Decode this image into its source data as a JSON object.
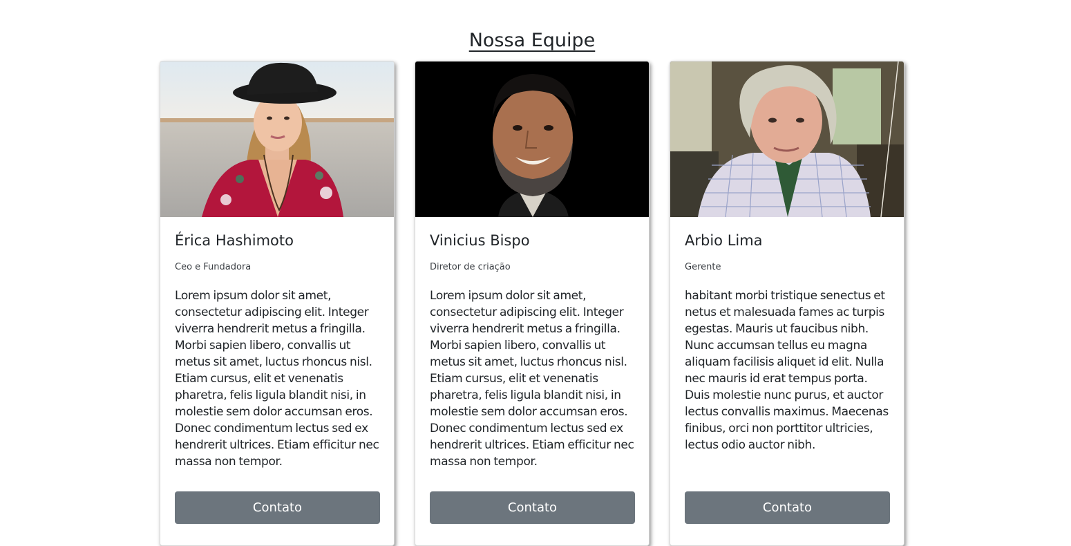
{
  "page": {
    "title": "Nossa Equipe"
  },
  "members": [
    {
      "photo_alt": "Érica Hashimoto",
      "name": "Érica Hashimoto",
      "role": "Ceo e Fundadora",
      "bio": "Lorem ipsum dolor sit amet, consectetur adipiscing elit. Integer viverra hendrerit metus a fringilla. Morbi sapien libero, convallis ut metus sit amet, luctus rhoncus nisl. Etiam cursus, elit et venenatis pharetra, felis ligula blandit nisi, in molestie sem dolor accumsan eros. Donec condimentum lectus sed ex hendrerit ultrices. Etiam efficitur nec massa non tempor.",
      "button_label": "Contato"
    },
    {
      "photo_alt": "Vinicius Bispo",
      "name": "Vinicius Bispo",
      "role": "Diretor de criação",
      "bio": "Lorem ipsum dolor sit amet, consectetur adipiscing elit. Integer viverra hendrerit metus a fringilla. Morbi sapien libero, convallis ut metus sit amet, luctus rhoncus nisl. Etiam cursus, elit et venenatis pharetra, felis ligula blandit nisi, in molestie sem dolor accumsan eros. Donec condimentum lectus sed ex hendrerit ultrices. Etiam efficitur nec massa non tempor.",
      "button_label": "Contato"
    },
    {
      "photo_alt": "Arbio Lima",
      "name": "Arbio Lima",
      "role": "Gerente",
      "bio": "habitant morbi tristique senectus et netus et malesuada fames ac turpis egestas. Mauris ut faucibus nibh. Nunc accumsan tellus eu magna aliquam facilisis aliquet id elit. Nulla nec mauris id erat tempus porta. Duis molestie nunc purus, et auctor lectus convallis maximus. Maecenas finibus, orci non porttitor ultricies, lectus odio auctor nibh.",
      "button_label": "Contato"
    }
  ],
  "colors": {
    "button": "#6c757d",
    "text": "#212529"
  }
}
